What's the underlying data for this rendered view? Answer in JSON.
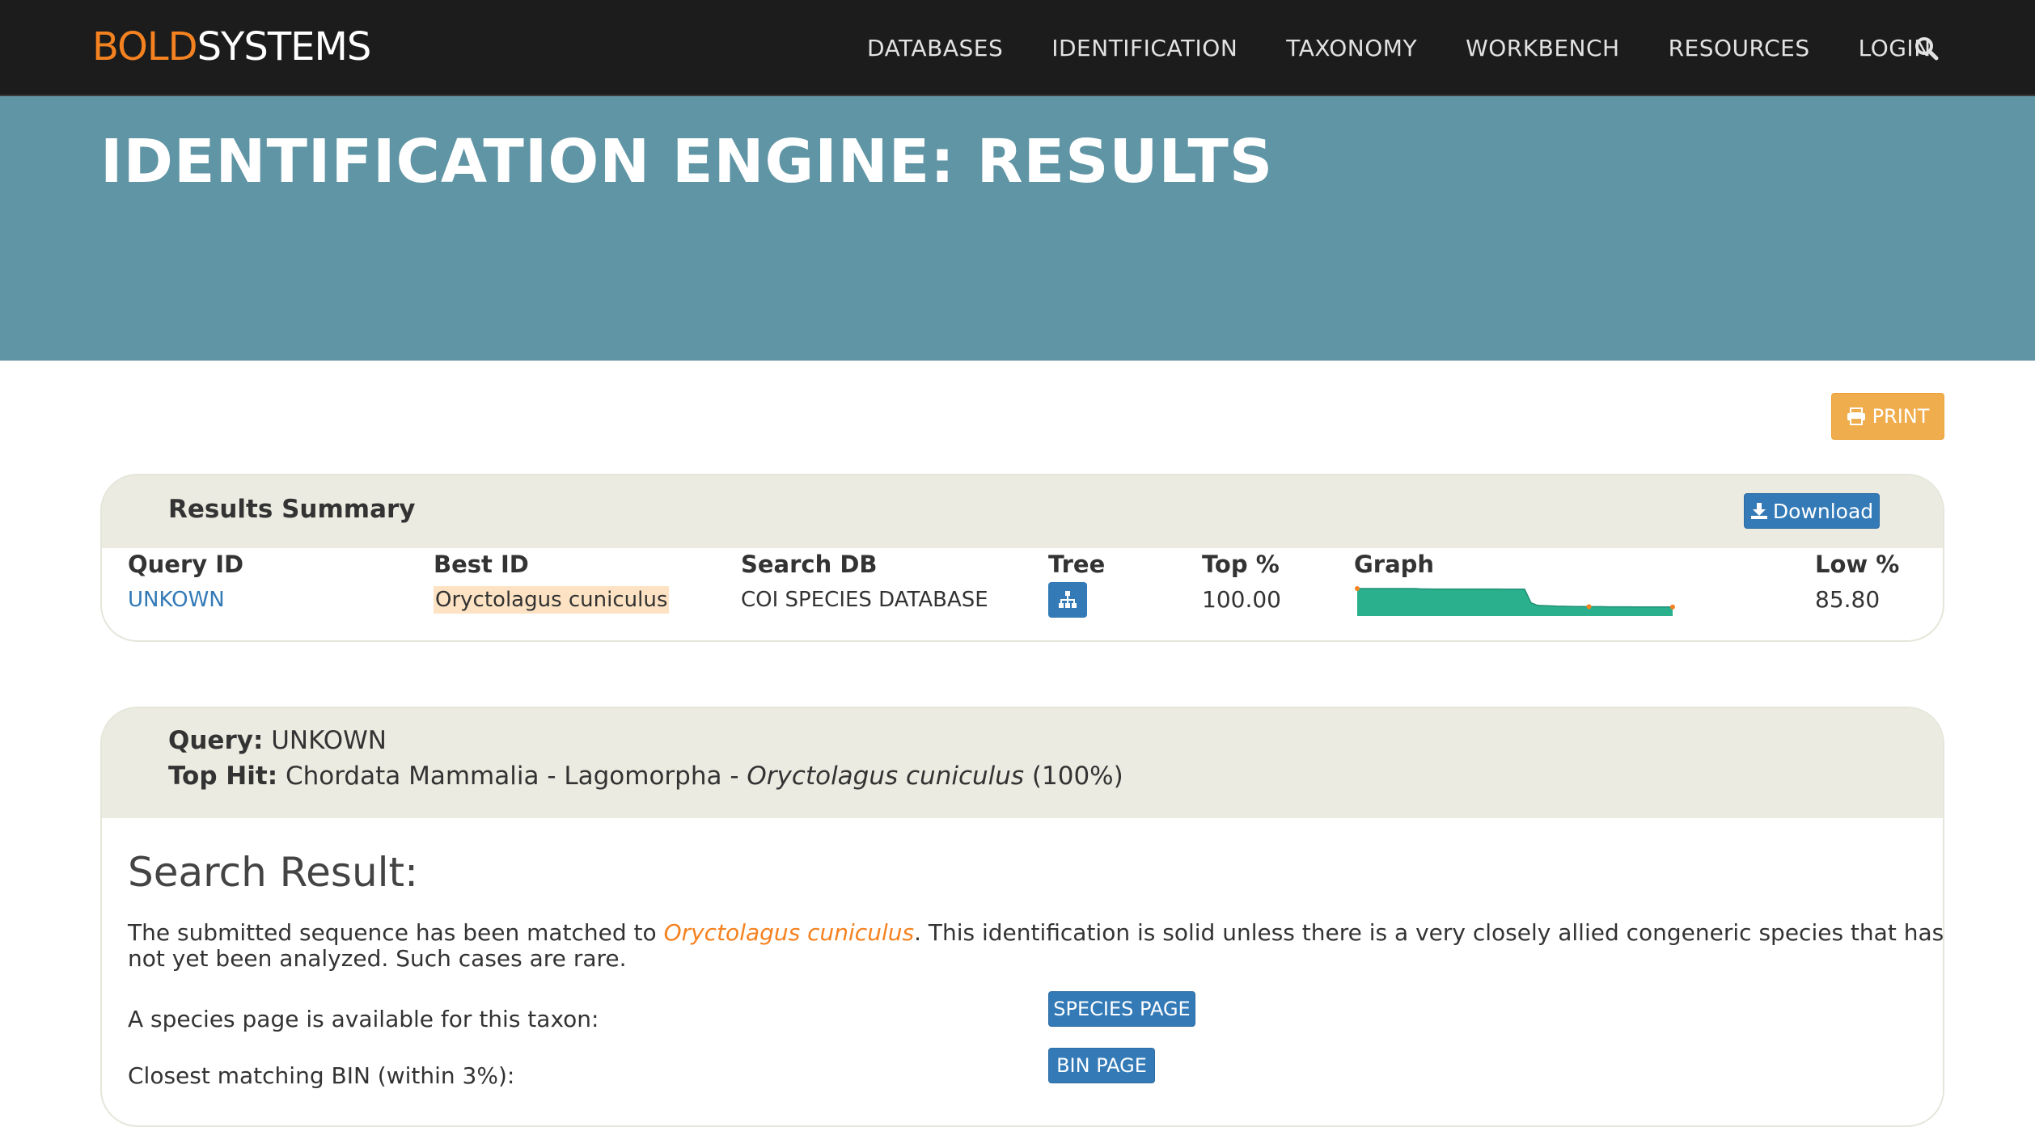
{
  "brand": {
    "part1": "BOLD",
    "part2": "SYSTEMS",
    "accent_color": "#f58220"
  },
  "nav": {
    "items": [
      "DATABASES",
      "IDENTIFICATION",
      "TAXONOMY",
      "WORKBENCH",
      "RESOURCES",
      "LOGIN"
    ],
    "search_icon": "search-icon"
  },
  "banner": {
    "title": "IDENTIFICATION ENGINE: RESULTS",
    "color": "#5f95a4"
  },
  "print_button": {
    "label": "PRINT",
    "icon": "printer-icon"
  },
  "summary": {
    "title": "Results Summary",
    "download_label": "Download",
    "columns": {
      "query_id": "Query ID",
      "best_id": "Best ID",
      "search_db": "Search DB",
      "tree": "Tree",
      "top_pct": "Top %",
      "graph": "Graph",
      "low_pct": "Low %"
    },
    "row": {
      "query_id": "UNKOWN",
      "best_id": "Oryctolagus cuniculus",
      "search_db": "COI SPECIES DATABASE",
      "top_pct": "100.00",
      "low_pct": "85.80"
    },
    "graph_series": [
      100,
      100,
      100,
      100,
      100,
      100,
      100,
      100,
      100,
      100,
      99.7,
      99.7,
      99.6,
      99.6,
      99.6,
      99.6,
      99.6,
      99.6,
      99.6,
      99.6,
      99.6,
      99.6,
      99.6,
      99.5,
      99.5,
      99.5,
      99.5,
      89,
      87,
      86.8,
      86.6,
      86.4,
      86.3,
      86.2,
      86.1,
      86.1,
      86.0,
      86.0,
      86.0,
      85.9,
      85.9,
      85.9,
      85.9,
      85.8,
      85.8,
      85.8,
      85.8,
      85.8,
      85.8,
      85.8
    ],
    "graph_color": "#2bb08e"
  },
  "query": {
    "query_label": "Query:",
    "query_value": "UNKOWN",
    "tophit_label": "Top Hit:",
    "tophit_prefix": "Chordata Mammalia - Lagomorpha - ",
    "tophit_species": "Oryctolagus cuniculus",
    "tophit_suffix": " (100%)"
  },
  "result": {
    "title": "Search Result:",
    "text_before": "The submitted sequence has been matched to ",
    "species": "Oryctolagus cuniculus",
    "text_after": ". This identification is solid unless there is a very closely allied congeneric species that has not yet been analyzed. Such cases are rare.",
    "species_page_label": "A species page is available for this taxon:",
    "species_page_button": "SPECIES PAGE",
    "bin_label": "Closest matching BIN (within 3%):",
    "bin_button": "BIN PAGE"
  }
}
